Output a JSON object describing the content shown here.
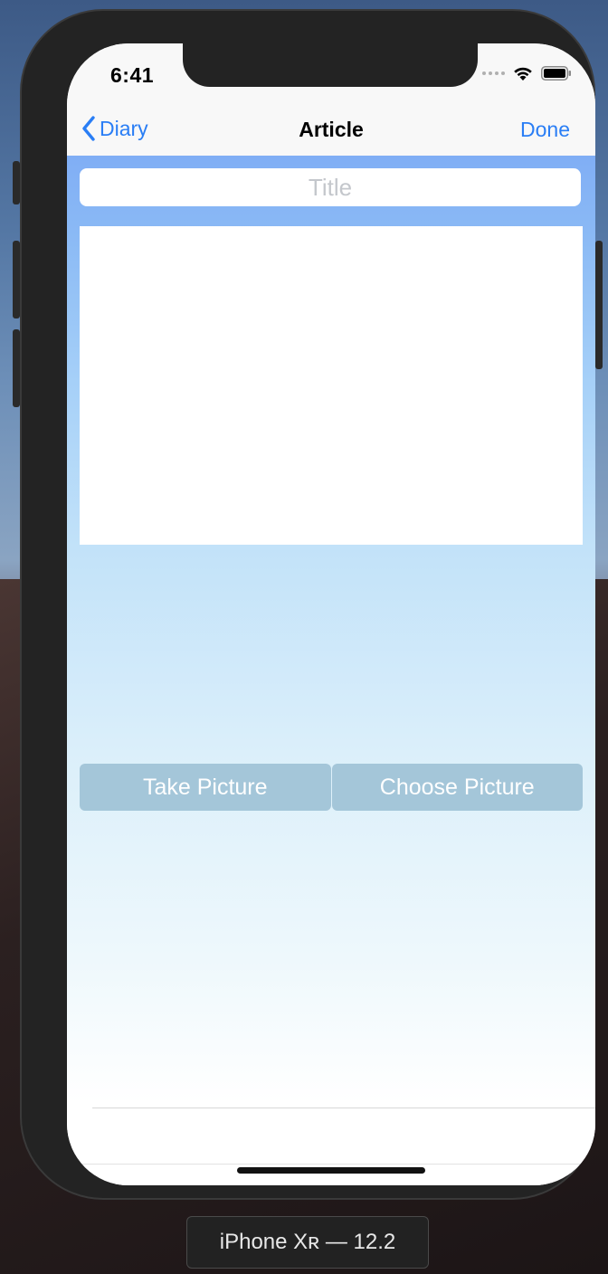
{
  "status_bar": {
    "time": "6:41"
  },
  "nav": {
    "back_label": "Diary",
    "title": "Article",
    "done_label": "Done"
  },
  "form": {
    "title_placeholder": "Title",
    "title_value": "",
    "body_value": ""
  },
  "buttons": {
    "take_picture": "Take Picture",
    "choose_picture": "Choose Picture"
  },
  "device_label": "iPhone Xʀ — 12.2",
  "colors": {
    "accent": "#2a7ef5",
    "button_bg": "#a4c6d9"
  },
  "icons": [
    "chevron-left-icon",
    "cellular-signal-icon",
    "wifi-icon",
    "battery-icon"
  ]
}
